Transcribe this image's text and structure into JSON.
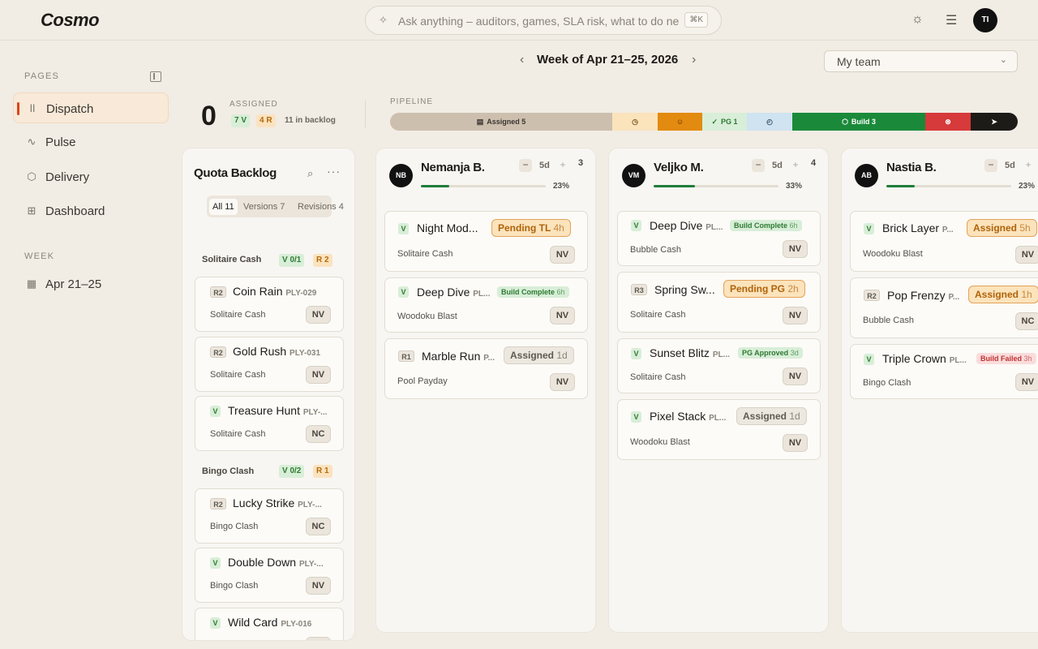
{
  "header": {
    "logo": "Cosmo",
    "search_placeholder": "Ask anything – auditors, games, SLA risk, what to do ne",
    "search_shortcut": "⌘K",
    "avatar_initials": "TI"
  },
  "sidebar": {
    "pages_label": "PAGES",
    "items": [
      {
        "label": "Dispatch",
        "icon": "dispatch-icon"
      },
      {
        "label": "Pulse",
        "icon": "pulse-icon"
      },
      {
        "label": "Delivery",
        "icon": "box-icon"
      },
      {
        "label": "Dashboard",
        "icon": "grid-icon"
      }
    ],
    "week_label": "WEEK",
    "week_item": "Apr 21–25"
  },
  "week": {
    "title": "Week of Apr 21–25, 2026"
  },
  "team_select": {
    "value": "My team"
  },
  "summary": {
    "assigned_count": "0",
    "assigned_label": "ASSIGNED",
    "v_badge": "7 V",
    "r_badge": "4 R",
    "backlog_note": "11 in backlog"
  },
  "pipeline": {
    "label": "PIPELINE",
    "segments": [
      {
        "label": "Assigned 5",
        "color": "#cdbfae"
      },
      {
        "label": "",
        "color": "#fbe3bc"
      },
      {
        "label": "",
        "color": "#e38a10"
      },
      {
        "label": "PG 1",
        "color": "#d8eed8"
      },
      {
        "label": "",
        "color": "#cfe3f0"
      },
      {
        "label": "Build 3",
        "color": "#1a8a3a"
      },
      {
        "label": "",
        "color": "#d63a3a"
      },
      {
        "label": "",
        "color": "#1d1b18"
      }
    ]
  },
  "backlog": {
    "title": "Quota Backlog",
    "tabs": [
      {
        "label": "All",
        "count": "11"
      },
      {
        "label": "Versions",
        "count": "7"
      },
      {
        "label": "Revisions",
        "count": "4"
      }
    ],
    "groups": [
      {
        "name": "Solitaire Cash",
        "v": "V 0/1",
        "r": "R 2"
      },
      {
        "name": "Bingo Clash",
        "v": "V 0/2",
        "r": "R 1"
      }
    ],
    "cards": [
      {
        "tag": "R2",
        "title": "Coin Rain",
        "id": "PLY-029",
        "game": "Solitaire Cash",
        "initials": "NV"
      },
      {
        "tag": "R2",
        "title": "Gold Rush",
        "id": "PLY-031",
        "game": "Solitaire Cash",
        "initials": "NV"
      },
      {
        "tag": "V",
        "title": "Treasure Hunt",
        "id": "PLY-...",
        "game": "Solitaire Cash",
        "initials": "NC"
      },
      {
        "tag": "R2",
        "title": "Lucky Strike",
        "id": "PLY-...",
        "game": "Bingo Clash",
        "initials": "NC"
      },
      {
        "tag": "V",
        "title": "Double Down",
        "id": "PLY-...",
        "game": "Bingo Clash",
        "initials": "NV"
      },
      {
        "tag": "V",
        "title": "Wild Card",
        "id": "PLY-016",
        "game": "",
        "initials": ""
      }
    ]
  },
  "engineers": [
    {
      "initials": "NB",
      "name": "Nemanja B.",
      "days": "5d",
      "count": "3",
      "pct": "23%",
      "fill": 0.23,
      "cards": [
        {
          "tag": "V",
          "title": "Night Mod...",
          "game": "Solitaire Cash",
          "initials": "NV",
          "status": "Pending TL",
          "time": "4h"
        },
        {
          "tag": "V",
          "title": "Deep Dive",
          "id": "PL...",
          "game": "Woodoku Blast",
          "initials": "NV",
          "status": "Build Complete",
          "time": "6h"
        },
        {
          "tag": "R1",
          "title": "Marble Run",
          "id": "P...",
          "game": "Pool Payday",
          "initials": "NV",
          "status": "Assigned",
          "time": "1d"
        }
      ]
    },
    {
      "initials": "VM",
      "name": "Veljko M.",
      "days": "5d",
      "count": "4",
      "pct": "33%",
      "fill": 0.33,
      "cards": [
        {
          "tag": "V",
          "title": "Deep Dive",
          "id": "PL...",
          "game": "Bubble Cash",
          "initials": "NV",
          "status": "Build Complete",
          "time": "6h"
        },
        {
          "tag": "R3",
          "title": "Spring Sw...",
          "game": "Solitaire Cash",
          "initials": "NV",
          "status": "Pending PG",
          "time": "2h"
        },
        {
          "tag": "V",
          "title": "Sunset Blitz",
          "id": "PL...",
          "game": "Solitaire Cash",
          "initials": "NV",
          "status": "PG Approved",
          "time": "3d"
        },
        {
          "tag": "V",
          "title": "Pixel Stack",
          "id": "PL...",
          "game": "Woodoku Blast",
          "initials": "NV",
          "status": "Assigned",
          "time": "1d"
        }
      ]
    },
    {
      "initials": "AB",
      "name": "Nastia B.",
      "days": "5d",
      "count": "",
      "pct": "23%",
      "fill": 0.23,
      "cards": [
        {
          "tag": "V",
          "title": "Brick Layer",
          "id": "P...",
          "game": "Woodoku Blast",
          "initials": "NV",
          "status": "Assigned",
          "time": "5h"
        },
        {
          "tag": "R2",
          "title": "Pop Frenzy",
          "id": "P...",
          "game": "Bubble Cash",
          "initials": "NC",
          "status": "Assigned",
          "time": "1h"
        },
        {
          "tag": "V",
          "title": "Triple Crown",
          "id": "PL...",
          "game": "Bingo Clash",
          "initials": "NV",
          "status": "Build Failed",
          "time": "3h"
        }
      ]
    }
  ]
}
